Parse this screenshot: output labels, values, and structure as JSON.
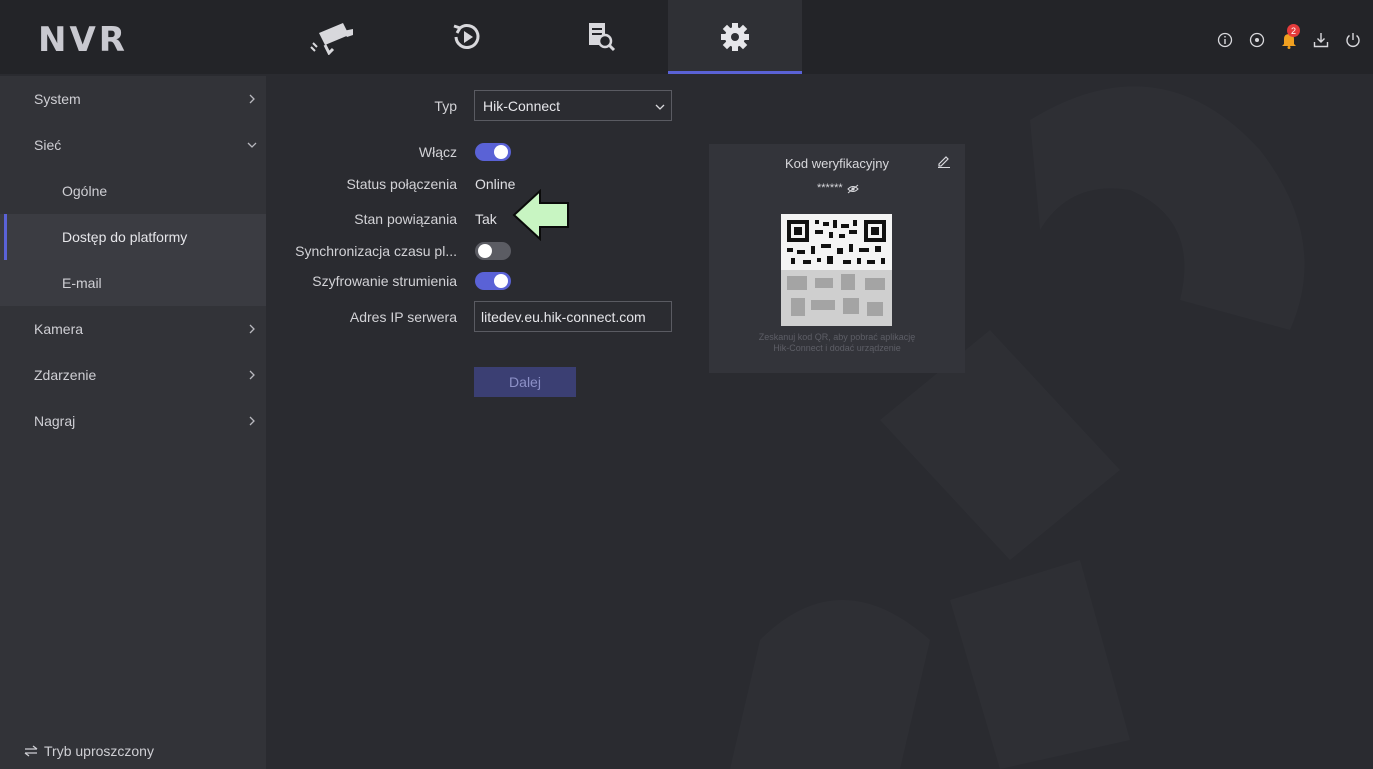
{
  "header": {
    "logo": "NVR",
    "nav": [
      {
        "name": "camera-icon"
      },
      {
        "name": "playback-icon"
      },
      {
        "name": "search-icon"
      },
      {
        "name": "settings-icon",
        "active": true
      }
    ],
    "badge_count": "2"
  },
  "sidebar": {
    "items": [
      {
        "label": "System",
        "level": "top",
        "chevron": "right"
      },
      {
        "label": "Sieć",
        "level": "top",
        "chevron": "down"
      },
      {
        "label": "Ogólne",
        "level": "sub"
      },
      {
        "label": "Dostęp do platformy",
        "level": "sub",
        "active": true
      },
      {
        "label": "E-mail",
        "level": "sub"
      },
      {
        "label": "Kamera",
        "level": "top",
        "chevron": "right"
      },
      {
        "label": "Zdarzenie",
        "level": "top",
        "chevron": "right"
      },
      {
        "label": "Nagraj",
        "level": "top",
        "chevron": "right"
      }
    ],
    "simple_mode": "Tryb uproszczony"
  },
  "form": {
    "type_label": "Typ",
    "type_value": "Hik-Connect",
    "enable_label": "Włącz",
    "enable_on": true,
    "status_label": "Status połączenia",
    "status_value": "Online",
    "bind_label": "Stan powiązania",
    "bind_value": "Tak",
    "sync_label": "Synchronizacja czasu pl...",
    "sync_on": false,
    "encrypt_label": "Szyfrowanie strumienia",
    "encrypt_on": true,
    "server_label": "Adres IP serwera",
    "server_value": "litedev.eu.hik-connect.com",
    "next_button": "Dalej"
  },
  "qr_panel": {
    "title": "Kod weryfikacyjny",
    "masked_code": "******",
    "note_line1": "Zeskanuj kod QR, aby pobrać aplikację",
    "note_line2": "Hik-Connect i dodać urządzenie"
  },
  "colors": {
    "accent": "#5a62d6",
    "arrow_fill": "#c8f5c2",
    "badge": "#e53b3b"
  }
}
